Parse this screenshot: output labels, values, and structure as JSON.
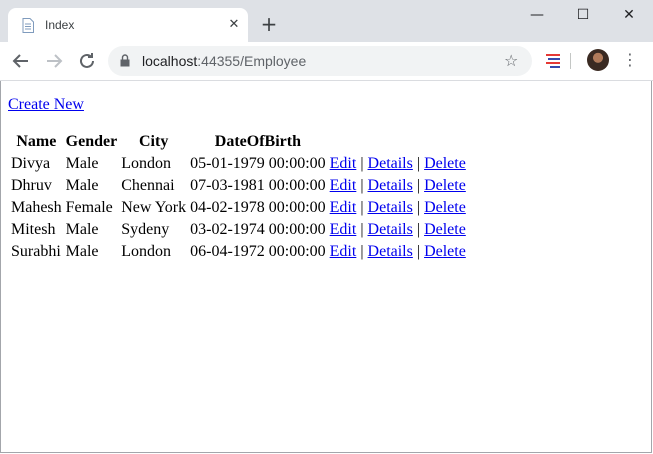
{
  "browser": {
    "tab_title": "Index",
    "tab_close": "✕",
    "new_tab": "+",
    "url_host": "localhost",
    "url_rest": ":44355/Employee",
    "window_controls": {
      "minimize": "—",
      "maximize": "☐",
      "close": "✕"
    }
  },
  "page": {
    "create_new": "Create New",
    "headers": [
      "Name",
      "Gender",
      "City",
      "DateOfBirth"
    ],
    "rows": [
      [
        "Divya",
        "Male",
        "London",
        "05-01-1979 00:00:00"
      ],
      [
        "Dhruv",
        "Male",
        "Chennai",
        "07-03-1981 00:00:00"
      ],
      [
        "Mahesh",
        "Female",
        "New York",
        "04-02-1978 00:00:00"
      ],
      [
        "Mitesh",
        "Male",
        "Sydeny",
        "03-02-1974 00:00:00"
      ],
      [
        "Surabhi",
        "Male",
        "London",
        "06-04-1972 00:00:00"
      ]
    ],
    "actions": {
      "edit": "Edit",
      "details": "Details",
      "delete": "Delete",
      "sep": "|"
    }
  },
  "colors": {
    "link": "#0000ee",
    "titlebar": "#dee1e6"
  }
}
